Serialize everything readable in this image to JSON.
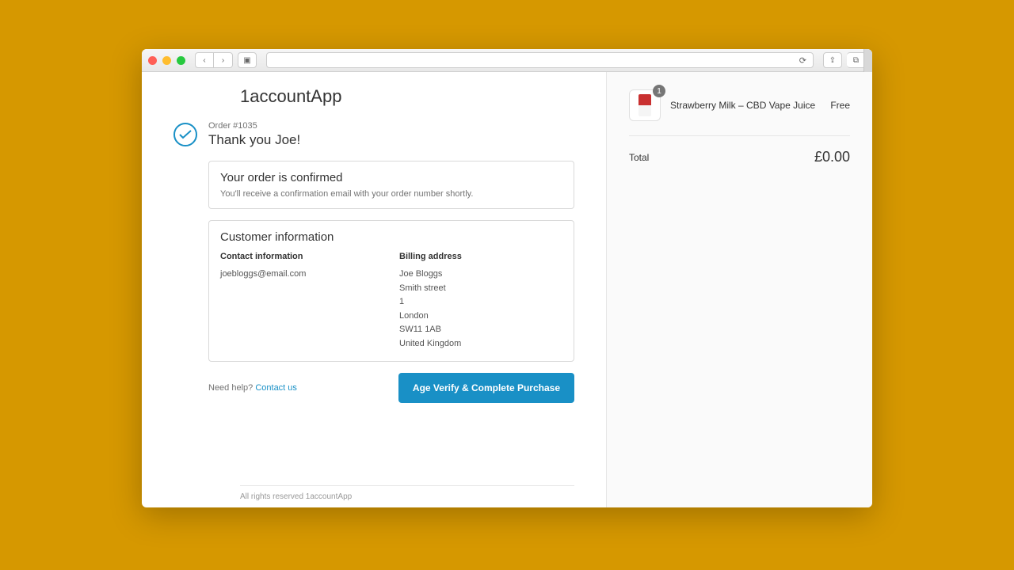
{
  "store": {
    "name": "1accountApp"
  },
  "header": {
    "order_number": "Order #1035",
    "thank_you": "Thank you Joe!"
  },
  "confirmed": {
    "title": "Your order is confirmed",
    "subtitle": "You'll receive a confirmation email with your order number shortly."
  },
  "customer": {
    "section_title": "Customer information",
    "contact_label": "Contact information",
    "contact_email": "joebloggs@email.com",
    "billing_label": "Billing address",
    "billing_lines": [
      "Joe Bloggs",
      "Smith street",
      "1",
      "London",
      "SW11 1AB",
      "United Kingdom"
    ]
  },
  "actions": {
    "help_prefix": "Need help? ",
    "help_link": "Contact us",
    "primary_button": "Age Verify & Complete Purchase"
  },
  "footer": {
    "rights": "All rights reserved 1accountApp"
  },
  "summary": {
    "item": {
      "qty": "1",
      "name": "Strawberry Milk – CBD Vape Juice",
      "price": "Free"
    },
    "total_label": "Total",
    "total_amount": "£0.00"
  }
}
